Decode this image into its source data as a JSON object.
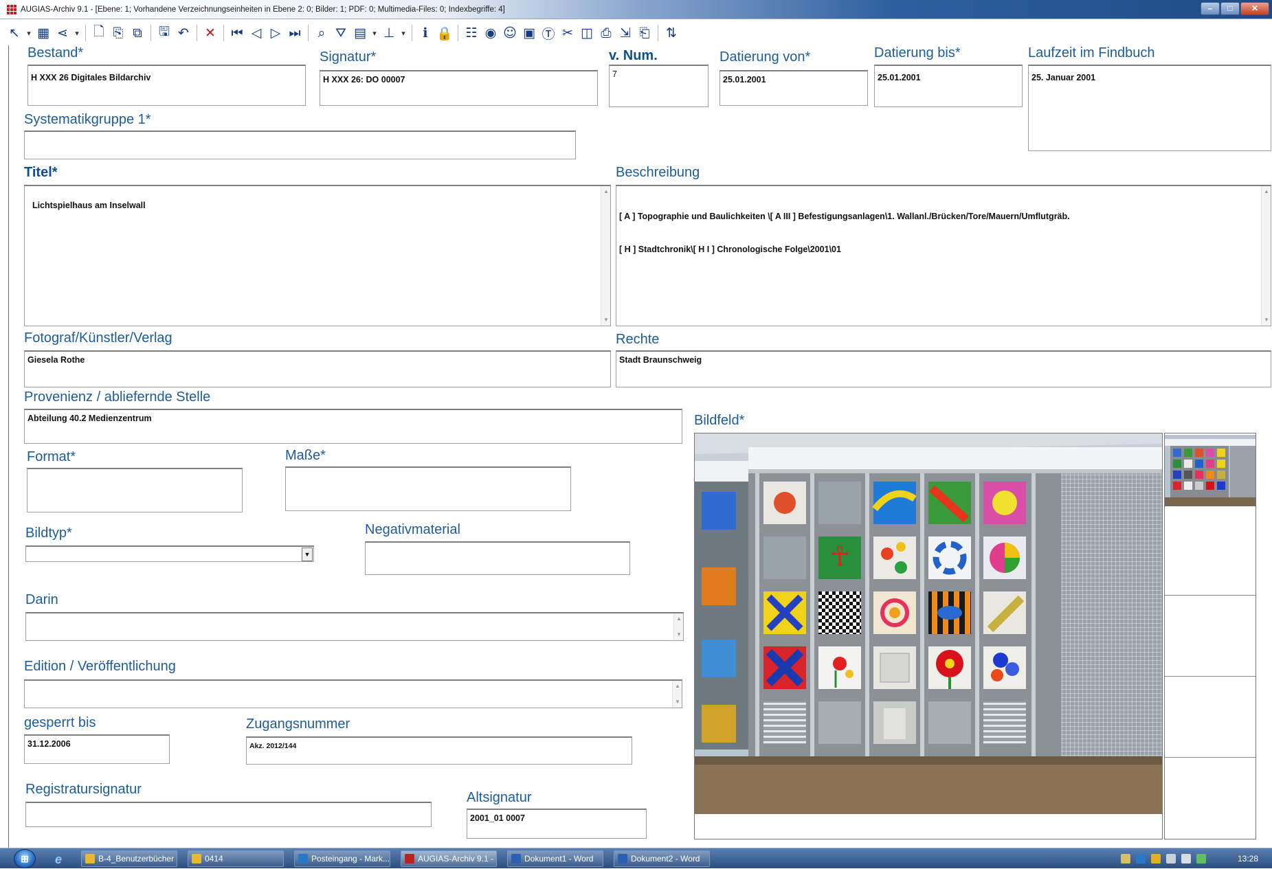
{
  "window": {
    "title": "AUGIAS-Archiv 9.1 - [Ebene: 1; Vorhandene Verzeichnungseinheiten in Ebene 2: 0; Bilder: 1; PDF: 0; Multimedia-Files: 0; Indexbegriffe: 4]",
    "minimize": "–",
    "maximize": "□",
    "close": "✕"
  },
  "toolbar": {
    "icons": [
      "select-arrow-icon",
      "grid-icon",
      "tree-icon",
      "new-record-icon",
      "copy-record-icon",
      "copy-all-icon",
      "save-icon",
      "undo-icon",
      "delete-icon",
      "first-record-icon",
      "prev-record-icon",
      "next-record-icon",
      "last-record-icon",
      "search-icon",
      "filter-icon",
      "calculator-icon",
      "stamp-icon",
      "info-icon",
      "lock-icon",
      "index-icon",
      "media-icon",
      "people-icon",
      "document-icon",
      "text-icon",
      "tools-icon",
      "di-icon",
      "print-icon",
      "export-icon",
      "report-icon",
      "sort-icon"
    ]
  },
  "form": {
    "bestand": {
      "label": "Bestand*",
      "value": "H XXX 26 Digitales Bildarchiv"
    },
    "signatur": {
      "label": "Signatur*",
      "value": "H XXX 26: DO 00007"
    },
    "vnum": {
      "label": "v. Num.",
      "value": "7"
    },
    "datierung_von": {
      "label": "Datierung von*",
      "value": "25.01.2001"
    },
    "datierung_bis": {
      "label": "Datierung bis*",
      "value": "25.01.2001"
    },
    "laufzeit": {
      "label": "Laufzeit im Findbuch",
      "value": "25. Januar 2001"
    },
    "systematikgruppe": {
      "label": "Systematikgruppe 1*",
      "value": ""
    },
    "titel": {
      "label": "Titel*",
      "value": "Lichtspielhaus am Inselwall"
    },
    "beschreibung": {
      "label": "Beschreibung",
      "line1": "[ A ] Topographie und Baulichkeiten \\[ A III ] Befestigungsanlagen\\1. Wallanl./Brücken/Tore/Mauern/Umflutgräb.",
      "line2": "[ H ] Stadtchronik\\[ H I ] Chronologische Folge\\2001\\01"
    },
    "fotograf": {
      "label": "Fotograf/Künstler/Verlag",
      "value": "Giesela Rothe"
    },
    "rechte": {
      "label": "Rechte",
      "value": "Stadt Braunschweig"
    },
    "provenienz": {
      "label": "Provenienz / abliefernde Stelle",
      "value": "Abteilung 40.2 Medienzentrum"
    },
    "bildfeld": {
      "label": "Bildfeld*"
    },
    "format": {
      "label": "Format*",
      "value": ""
    },
    "masse": {
      "label": "Maße*",
      "value": ""
    },
    "bildtyp": {
      "label": "Bildtyp*",
      "value": ""
    },
    "negativmaterial": {
      "label": "Negativmaterial",
      "value": ""
    },
    "darin": {
      "label": "Darin",
      "value": ""
    },
    "edition": {
      "label": "Edition / Veröffentlichung",
      "value": ""
    },
    "gesperrt_bis": {
      "label": "gesperrt bis",
      "value": "31.12.2006"
    },
    "zugangsnummer": {
      "label": "Zugangsnummer",
      "value": "Akz. 2012/144"
    },
    "registratursignatur": {
      "label": "Registratursignatur",
      "value": ""
    },
    "altsignatur": {
      "label": "Altsignatur",
      "value": "2001_01 0007"
    }
  },
  "taskbar": {
    "items": [
      {
        "label": "B-4_Benutzerbücher",
        "color": "#e8b830"
      },
      {
        "label": "0414",
        "color": "#e8b830"
      },
      {
        "label": "Posteingang - Mark...",
        "color": "#2a78c8"
      },
      {
        "label": "AUGIAS-Archiv 9.1 - ...",
        "color": "#c0201e"
      },
      {
        "label": "Dokument1 - Word",
        "color": "#2b5fb4"
      },
      {
        "label": "Dokument2 - Word",
        "color": "#2b5fb4"
      }
    ],
    "clock": "13:28"
  },
  "colors": {
    "label": "#1c5c9c",
    "accent_red": "#c41515",
    "toolbar_blue": "#123a8c"
  }
}
